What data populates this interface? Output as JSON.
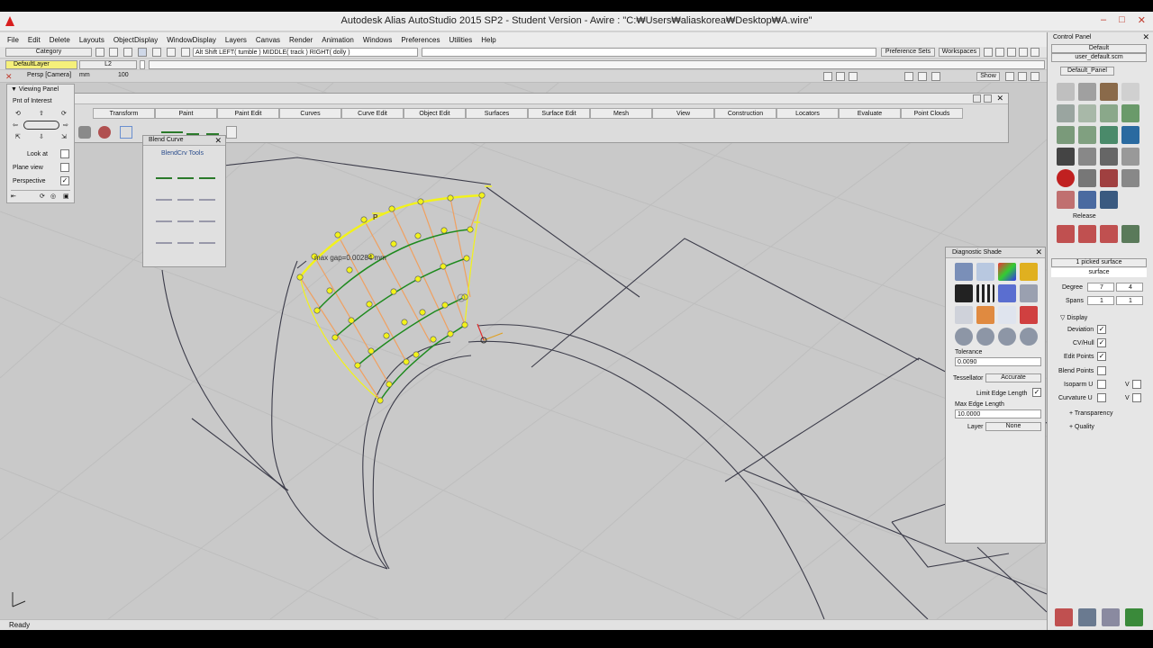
{
  "window": {
    "title": "Autodesk Alias AutoStudio 2015 SP2 - Student Version   -  Awire : \"C:₩Users₩aliaskorea₩Desktop₩A.wire\"",
    "minimize": "–",
    "maximize": "□",
    "close": "✕"
  },
  "menu": [
    "File",
    "Edit",
    "Delete",
    "Layouts",
    "ObjectDisplay",
    "WindowDisplay",
    "Layers",
    "Canvas",
    "Render",
    "Animation",
    "Windows",
    "Preferences",
    "Utilities",
    "Help"
  ],
  "toolbar": {
    "category_label": "Category",
    "mouse_hint": "Alt Shift   LEFT( tumble )   MIDDLE( track )   RIGHT( dolly )",
    "preference_sets": "Preference Sets",
    "workspaces": "Workspaces",
    "layer_name": "DefaultLayer",
    "layer_field": "L2",
    "camera_label": "Persp [Camera]",
    "camera_unit": "mm",
    "camera_value": "100",
    "show_button": "Show"
  },
  "shelf_tabs": [
    "Transform",
    "Paint",
    "Paint Edit",
    "Curves",
    "Curve Edit",
    "Object Edit",
    "Surfaces",
    "Surface Edit",
    "Mesh",
    "View",
    "Construction",
    "Locators",
    "Evaluate",
    "Point Clouds"
  ],
  "viewing_panel": {
    "title": "Viewing Panel",
    "poi": "Pnt of Interest",
    "look_at": "Look at",
    "plane_view": "Plane view",
    "perspective": "Perspective",
    "perspective_checked": "✓"
  },
  "blend_palette": {
    "title": "Blend Curve",
    "subtitle": "BlendCrv Tools"
  },
  "viewport": {
    "gap_readout": "max gap=0.00284 mm"
  },
  "diagnostic_shade": {
    "title": "Diagnostic Shade",
    "tolerance_label": "Tolerance",
    "tolerance_value": "0.0090",
    "tessellator_label": "Tessellator",
    "tessellator_value": "Accurate",
    "limit_edge_label": "Limit Edge Length",
    "max_edge_label": "Max Edge Length",
    "max_edge_value": "10.0000",
    "layer_label": "Layer",
    "layer_value": "None"
  },
  "control_panel": {
    "title": "Control Panel",
    "default_dropdown": "Default",
    "user_file": "user_default.scm",
    "panel_tab": "Default_Panel",
    "release_label": "Release",
    "picked": "1 picked surface",
    "object_type": "surface",
    "degree_label": "Degree",
    "degree_u": "7",
    "degree_v": "4",
    "spans_label": "Spans",
    "spans_u": "1",
    "spans_v": "1",
    "display_label": "Display",
    "deviation": "Deviation",
    "cvhull": "CV/Hull",
    "edit_points": "Edit Points",
    "blend_points": "Blend Points",
    "isoparm_u": "Isoparm U",
    "curvature_u": "Curvature U",
    "v_label": "V",
    "transparency": "Transparency",
    "quality": "Quality"
  },
  "status": {
    "text": "Ready"
  },
  "colors": {
    "accent_yellow": "#f2f21a",
    "cv_green": "#1e8a1e",
    "hull_orange": "#f0a060",
    "wire": "#3a3a4a"
  }
}
